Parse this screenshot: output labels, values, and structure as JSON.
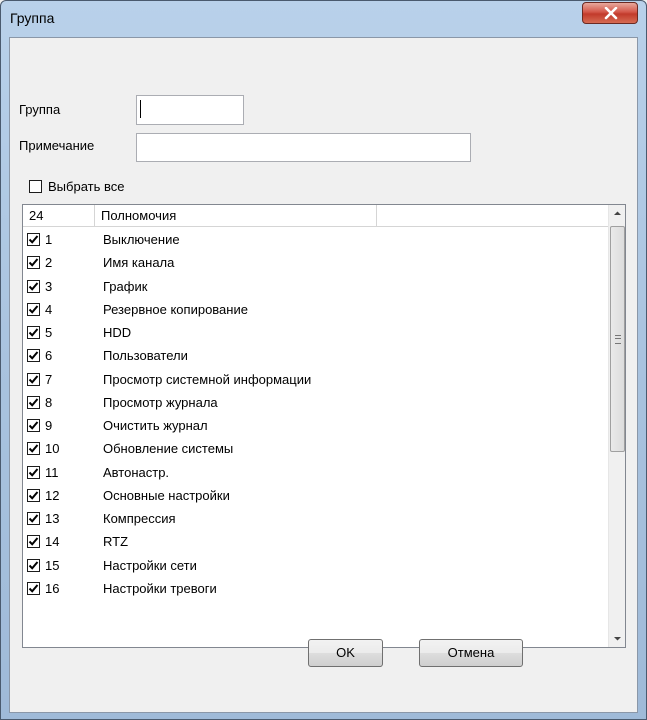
{
  "window": {
    "title": "Группа"
  },
  "form": {
    "group_label": "Группа",
    "group_value": "",
    "note_label": "Примечание",
    "note_value": "",
    "select_all_label": "Выбрать все",
    "select_all_checked": false
  },
  "list": {
    "columns": [
      "24",
      "Полномочия",
      ""
    ],
    "rows": [
      {
        "num": "1",
        "perm": "Выключение",
        "checked": true
      },
      {
        "num": "2",
        "perm": "Имя канала",
        "checked": true
      },
      {
        "num": "3",
        "perm": "График",
        "checked": true
      },
      {
        "num": "4",
        "perm": "Резервное копирование",
        "checked": true
      },
      {
        "num": "5",
        "perm": "HDD",
        "checked": true
      },
      {
        "num": "6",
        "perm": "Пользователи",
        "checked": true
      },
      {
        "num": "7",
        "perm": "Просмотр системной информации",
        "checked": true
      },
      {
        "num": "8",
        "perm": "Просмотр журнала",
        "checked": true
      },
      {
        "num": "9",
        "perm": "Очистить журнал",
        "checked": true
      },
      {
        "num": "10",
        "perm": "Обновление системы",
        "checked": true
      },
      {
        "num": "11",
        "perm": "Автонастр.",
        "checked": true
      },
      {
        "num": "12",
        "perm": "Основные настройки",
        "checked": true
      },
      {
        "num": "13",
        "perm": "Компрессия",
        "checked": true
      },
      {
        "num": "14",
        "perm": "RTZ",
        "checked": true
      },
      {
        "num": "15",
        "perm": "Настройки сети",
        "checked": true
      },
      {
        "num": "16",
        "perm": "Настройки тревоги",
        "checked": true
      }
    ]
  },
  "buttons": {
    "ok": "OK",
    "cancel": "Отмена"
  },
  "icons": {
    "close": "close-icon",
    "check": "checkmark-icon",
    "scroll_up": "arrow-up-icon",
    "scroll_down": "arrow-down-icon"
  }
}
